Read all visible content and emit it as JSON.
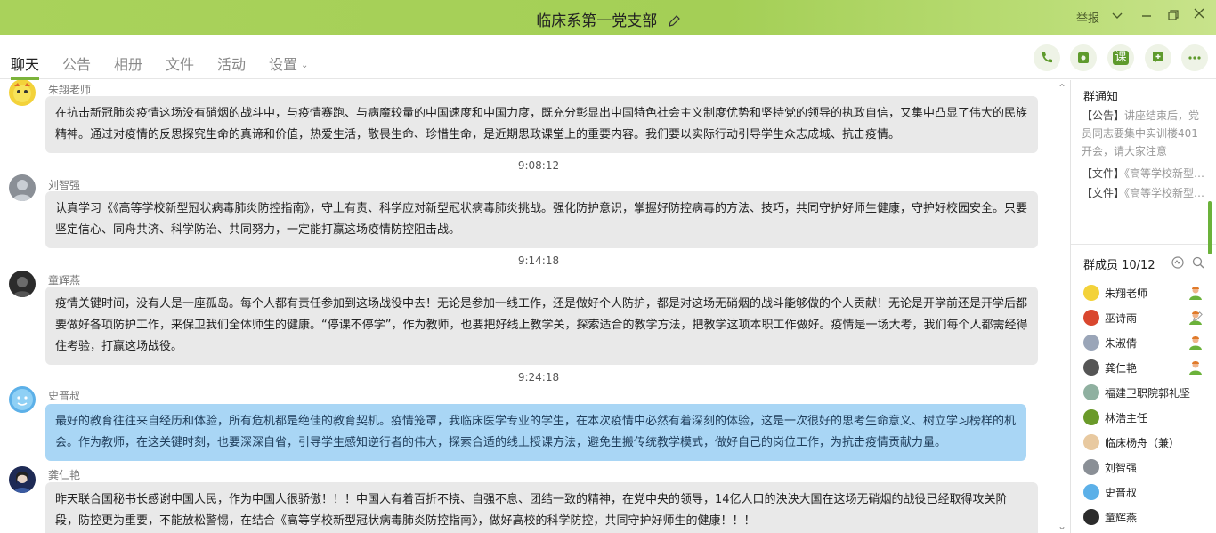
{
  "window": {
    "title": "临床系第一党支部",
    "report_label": "举报"
  },
  "tabs": [
    {
      "label": "聊天",
      "active": true
    },
    {
      "label": "公告"
    },
    {
      "label": "相册"
    },
    {
      "label": "文件"
    },
    {
      "label": "活动"
    },
    {
      "label": "设置"
    }
  ],
  "toolbar": {
    "course_label": "课"
  },
  "messages": [
    {
      "sender": "朱翔老师",
      "text": "在抗击新冠肺炎疫情这场没有硝烟的战斗中，与疫情赛跑、与病魔较量的中国速度和中国力度，既充分彰显出中国特色社会主义制度优势和坚持党的领导的执政自信，又集中凸显了伟大的民族精神。通过对疫情的反思探究生命的真谛和价值，热爱生活，敬畏生命、珍惜生命，是近期思政课堂上的重要内容。我们要以实际行动引导学生众志成城、抗击疫情。"
    },
    {
      "time": "9:08:12",
      "sender": "刘智强",
      "text": "认真学习《《高等学校新型冠状病毒肺炎防控指南》，守土有责、科学应对新型冠状病毒肺炎挑战。强化防护意识，掌握好防控病毒的方法、技巧，共同守护好师生健康，守护好校园安全。只要坚定信心、同舟共济、科学防治、共同努力，一定能打赢这场疫情防控阻击战。"
    },
    {
      "time": "9:14:18",
      "sender": "童辉燕",
      "text": "疫情关键时间，没有人是一座孤岛。每个人都有责任参加到这场战役中去！无论是参加一线工作，还是做好个人防护，都是对这场无硝烟的战斗能够做的个人贡献！无论是开学前还是开学后都要做好各项防护工作，来保卫我们全体师生的健康。“停课不停学”，作为教师，也要把好线上教学关，探索适合的教学方法，把教学这项本职工作做好。疫情是一场大考，我们每个人都需经得住考验，打赢这场战役。"
    },
    {
      "time": "9:24:18",
      "sender": "史晋叔",
      "text": "最好的教育往往来自经历和体验，所有危机都是绝佳的教育契机。疫情笼罩，我临床医学专业的学生，在本次疫情中必然有着深刻的体验，这是一次很好的思考生命意义、树立学习榜样的机会。作为教师，在这关键时刻，也要深深自省，引导学生感知逆行者的伟大，探索合适的线上授课方法，避免生搬传统教学模式，做好自己的岗位工作，为抗击疫情贡献力量。"
    },
    {
      "sender": "龚仁艳",
      "text": "昨天联合国秘书长感谢中国人民，作为中国人很骄傲！！！中国人有着百折不挠、自强不息、团结一致的精神，在党中央的领导，14亿人口的泱泱大国在这场无硝烟的战役已经取得攻关阶段，防控更为重要，不能放松警惕，在结合《高等学校新型冠状病毒肺炎防控指南》，做好高校的科学防控，共同守护好师生的健康！！！"
    }
  ],
  "notice": {
    "title": "群通知",
    "announcement_tag": "【公告】",
    "announcement_text": "讲座结束后，党员同志要集中实训楼401开会，请大家注意",
    "files": [
      {
        "tag": "【文件】",
        "name": "《高等学校新型冠状病毒肺炎防控指南》"
      },
      {
        "tag": "【文件】",
        "name": "《高等学校新型冠状病毒肺炎防控指南》"
      }
    ]
  },
  "members": {
    "title": "群成员 10/12",
    "list": [
      {
        "name": "朱翔老师",
        "admin": true
      },
      {
        "name": "巫诗雨",
        "admin": true
      },
      {
        "name": "朱淑倩",
        "admin": true
      },
      {
        "name": "龚仁艳",
        "admin": true
      },
      {
        "name": "福建卫职院郭礼坚"
      },
      {
        "name": "林浩主任"
      },
      {
        "name": "临床杨舟（兼）"
      },
      {
        "name": "刘智强"
      },
      {
        "name": "史晋叔"
      },
      {
        "name": "童辉燕"
      }
    ]
  },
  "colors": {
    "titlebar": "#a9d25b",
    "accent": "#7bb33a",
    "bubble_gray": "#e9e9e9",
    "bubble_blue": "#a9d6f5"
  }
}
